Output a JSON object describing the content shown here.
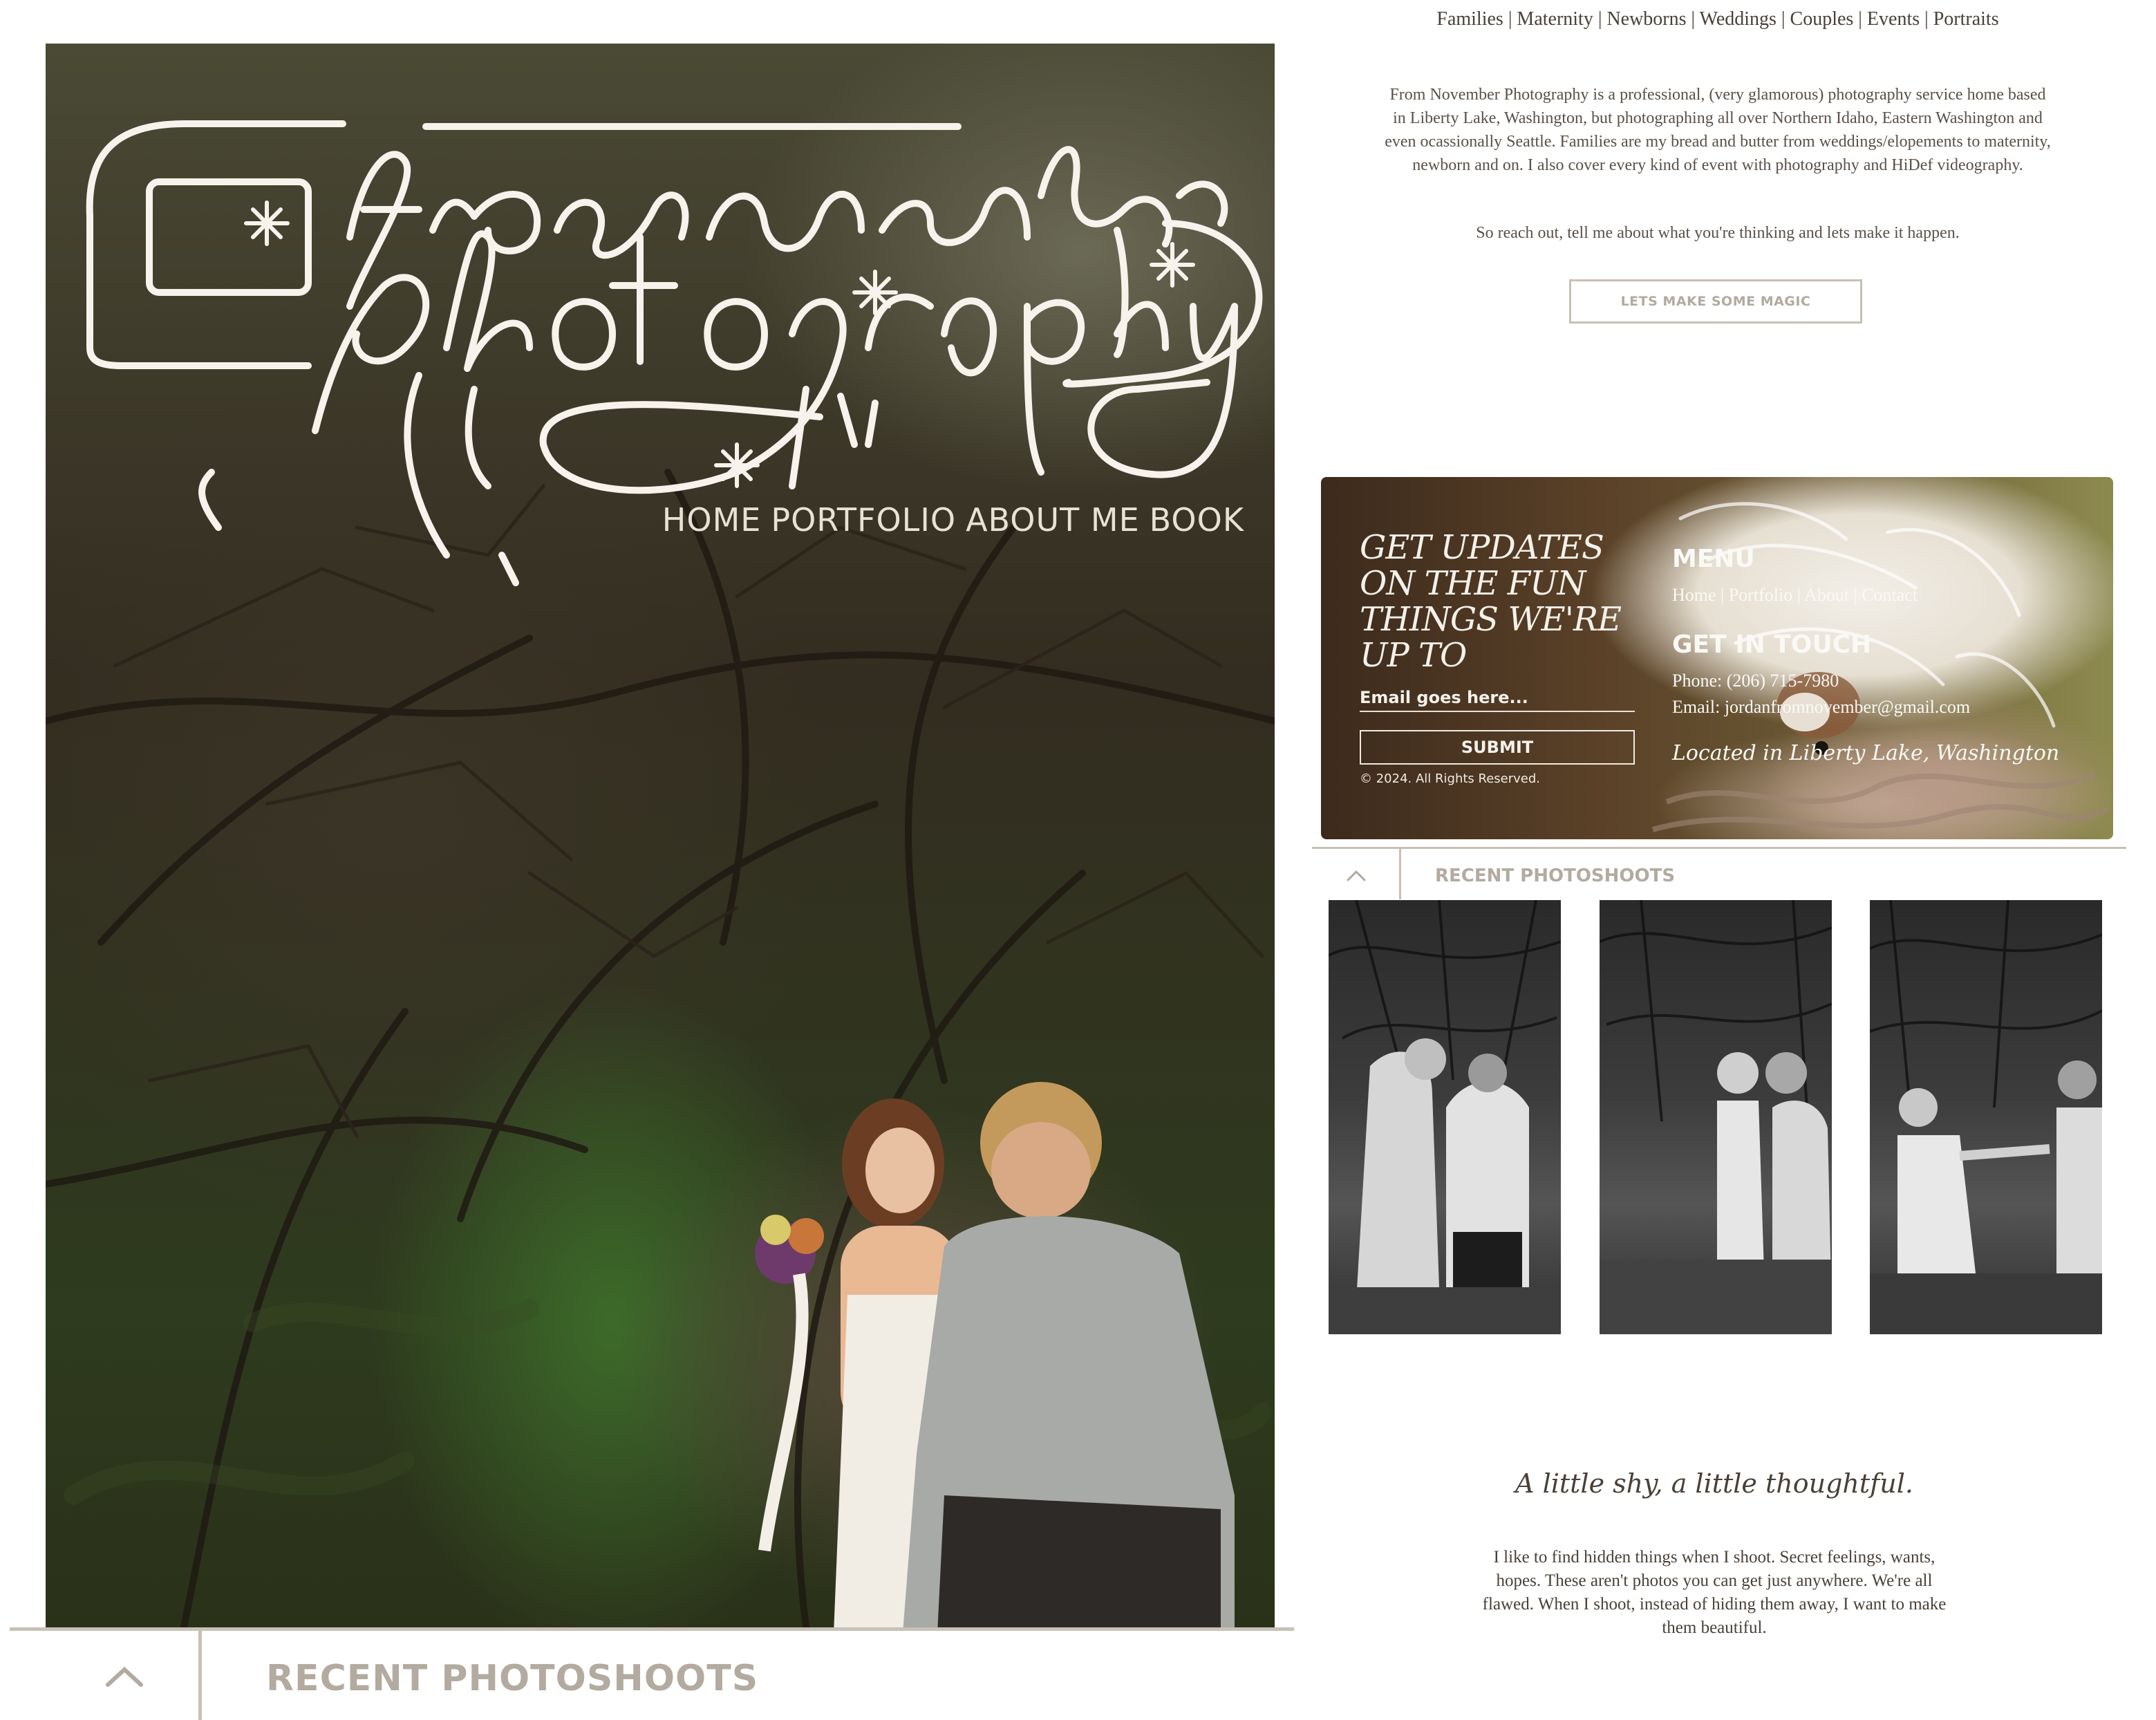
{
  "hero": {
    "nav": [
      "HOME",
      "PORTFOLIO",
      "ABOUT ME",
      "BOOK"
    ],
    "logo_text": "from november photography"
  },
  "left_section": {
    "recent_label": "RECENT PHOTOSHOOTS"
  },
  "categories": "Families | Maternity | Newborns | Weddings | Couples | Events | Portraits",
  "intro": {
    "paragraph": "From November Photography is a professional, (very glamorous) photography service home based in Liberty Lake, Washington, but photographing all over Northern Idaho, Eastern Washington and even ocassionally Seattle. Families are my bread and butter from weddings/elopements to maternity, newborn and on. I also cover every kind of event with photography and HiDef videography.",
    "cta_line": "So reach out, tell me about what you're thinking and lets make it happen.",
    "button": "LETS MAKE SOME MAGIC"
  },
  "newsletter": {
    "title": "GET UPDATES ON THE FUN THINGS WE'RE UP TO",
    "email_placeholder": "Email goes here...",
    "submit": "SUBMIT",
    "copyright": "© 2024. All Rights Reserved.",
    "menu_heading": "MENU",
    "menu_links": [
      "Home",
      "Portfolio",
      "About",
      "Contact"
    ],
    "contact_heading": "GET IN TOUCH",
    "phone": "Phone: (206) 715-7980",
    "email": "Email: jordanfromnovember@gmail.com",
    "location": "Located in Liberty Lake, Washington"
  },
  "recent": {
    "label": "RECENT PHOTOSHOOTS",
    "photos": [
      "photo-1",
      "photo-2",
      "photo-3"
    ]
  },
  "about": {
    "title": "A little shy, a little thoughtful.",
    "body": "I like to find hidden things when I shoot. Secret feelings, wants, hopes. These aren't photos you can get just anywhere. We're all flawed. When I shoot, instead of hiding them away, I want to make them beautiful."
  },
  "icons": {
    "up": "chevron-up-icon",
    "camera": "camera-frame-icon",
    "sparkle": "sparkle-icon"
  },
  "colors": {
    "accent_grey": "#b3aaa0",
    "line": "#c8c0b6",
    "text": "#4a4038"
  }
}
